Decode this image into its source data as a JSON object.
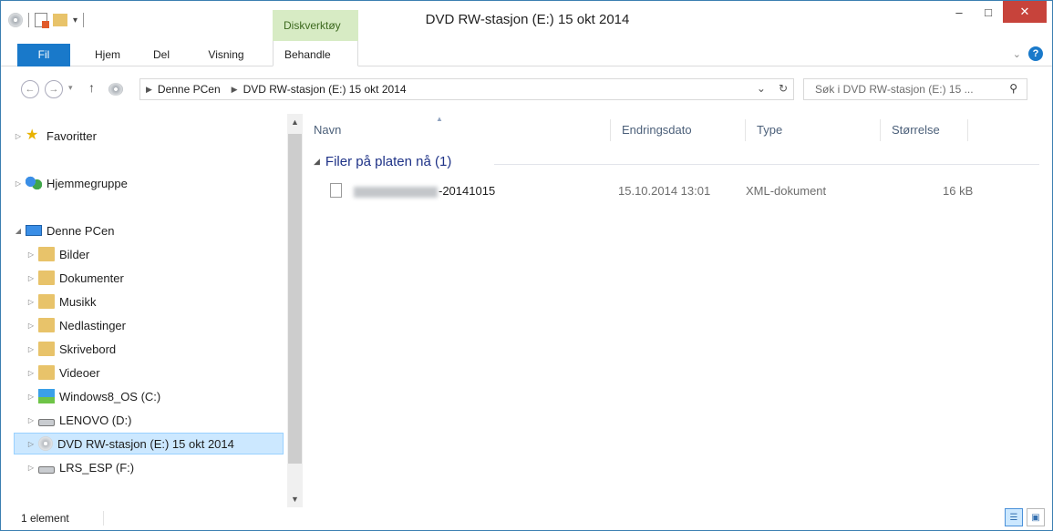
{
  "window": {
    "title": "DVD RW-stasjon (E:) 15 okt 2014",
    "context_group": "Diskverktøy",
    "controls": {
      "minimize": "–",
      "maximize": "□",
      "close": "✕"
    }
  },
  "ribbon": {
    "tabs": [
      "Fil",
      "Hjem",
      "Del",
      "Visning"
    ],
    "context_tab": "Behandle",
    "expand_icon": "chevron-down-icon",
    "help_icon": "?"
  },
  "address": {
    "breadcrumbs": [
      "Denne PCen",
      "DVD RW-stasjon (E:) 15 okt 2014"
    ],
    "search_placeholder": "Søk i DVD RW-stasjon (E:) 15 ..."
  },
  "nav": {
    "items": [
      {
        "label": "Favoritter",
        "icon": "star-icon",
        "level": 0,
        "expanded": false,
        "selected": false
      },
      {
        "label": "Hjemmegruppe",
        "icon": "homegroup-icon",
        "level": 0,
        "expanded": false,
        "selected": false
      },
      {
        "label": "Denne PCen",
        "icon": "computer-icon",
        "level": 0,
        "expanded": true,
        "selected": false
      },
      {
        "label": "Bilder",
        "icon": "folder-icon",
        "level": 1,
        "expanded": false,
        "selected": false
      },
      {
        "label": "Dokumenter",
        "icon": "folder-icon",
        "level": 1,
        "expanded": false,
        "selected": false
      },
      {
        "label": "Musikk",
        "icon": "folder-icon",
        "level": 1,
        "expanded": false,
        "selected": false
      },
      {
        "label": "Nedlastinger",
        "icon": "folder-icon",
        "level": 1,
        "expanded": false,
        "selected": false
      },
      {
        "label": "Skrivebord",
        "icon": "folder-icon",
        "level": 1,
        "expanded": false,
        "selected": false
      },
      {
        "label": "Videoer",
        "icon": "folder-icon",
        "level": 1,
        "expanded": false,
        "selected": false
      },
      {
        "label": "Windows8_OS (C:)",
        "icon": "windows-drive-icon",
        "level": 1,
        "expanded": false,
        "selected": false
      },
      {
        "label": "LENOVO (D:)",
        "icon": "drive-icon",
        "level": 1,
        "expanded": false,
        "selected": false
      },
      {
        "label": "DVD RW-stasjon (E:) 15 okt 2014",
        "icon": "disc-icon",
        "level": 1,
        "expanded": false,
        "selected": true
      },
      {
        "label": "LRS_ESP (F:)",
        "icon": "drive-icon",
        "level": 1,
        "expanded": false,
        "selected": false
      }
    ]
  },
  "list": {
    "columns": [
      "Navn",
      "Endringsdato",
      "Type",
      "Størrelse"
    ],
    "group_header": "Filer på platen nå (1)",
    "files": [
      {
        "name": "-20141015",
        "date": "15.10.2014 13:01",
        "type": "XML-dokument",
        "size": "16 kB"
      }
    ]
  },
  "status": {
    "count": "1 element"
  },
  "colors": {
    "file_tab": "#1979ca",
    "context_tab_bg": "#d7ebc4",
    "close_button": "#c7433b",
    "selection": "#cce8ff",
    "group_header": "#1e3287"
  }
}
